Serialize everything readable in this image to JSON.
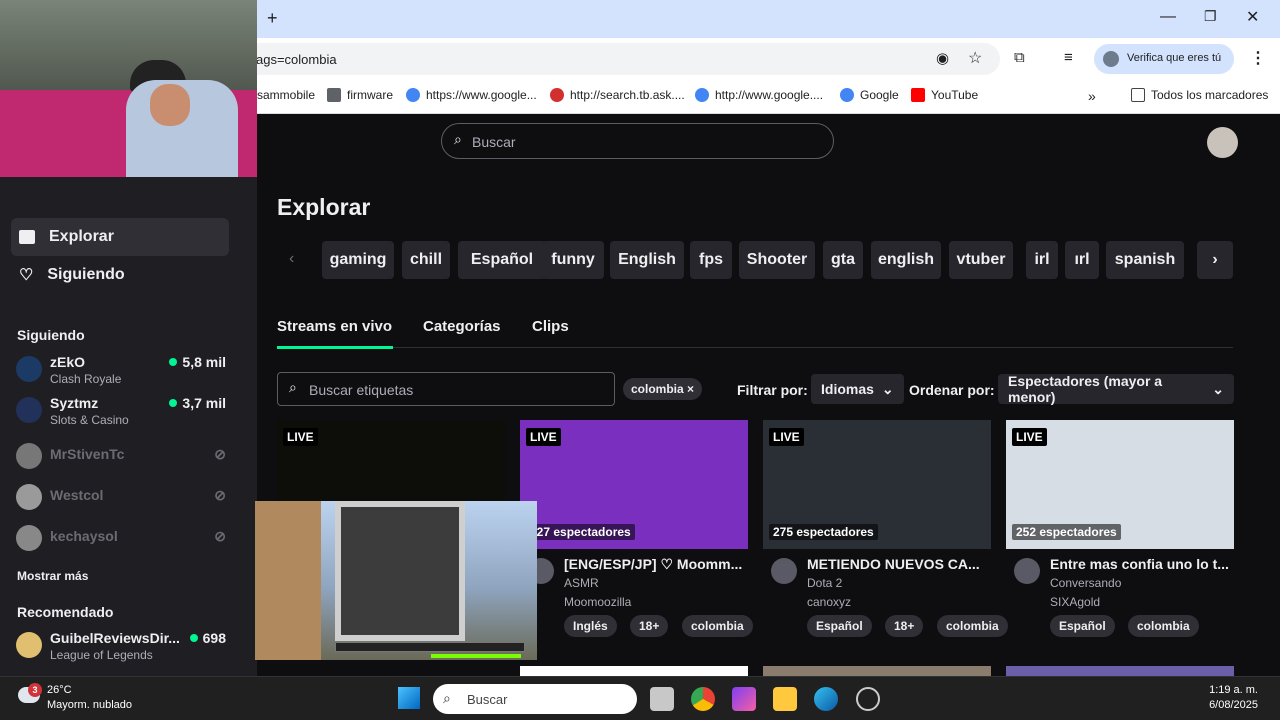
{
  "browser": {
    "new_tab_symbol": "+",
    "url": "ags=colombia",
    "profile_label": "Verifica que eres tú",
    "bookmarks": [
      {
        "label": "sammobile",
        "icon": "none"
      },
      {
        "label": "firmware",
        "icon": "folder-icon"
      },
      {
        "label": "https://www.google...",
        "icon": "google-icon"
      },
      {
        "label": "http://search.tb.ask....",
        "icon": "ask-icon"
      },
      {
        "label": "http://www.google....",
        "icon": "google-icon"
      },
      {
        "label": "Google",
        "icon": "google-icon"
      },
      {
        "label": "YouTube",
        "icon": "youtube-icon"
      }
    ],
    "more_symbol": "»",
    "all_bookmarks_label": "Todos los marcadores"
  },
  "site": {
    "search_placeholder": "Buscar",
    "page_title": "Explorar",
    "nav": [
      {
        "label": "Explorar",
        "icon": "explore-icon",
        "active": true
      },
      {
        "label": "Siguiendo",
        "icon": "heart-icon",
        "active": false
      }
    ],
    "following_heading": "Siguiendo",
    "following": [
      {
        "name": "zEkO",
        "game": "Clash Royale",
        "viewers": "5,8 mil",
        "live": true,
        "color": "#1b3a66"
      },
      {
        "name": "Syztmz",
        "game": "Slots & Casino",
        "viewers": "3,7 mil",
        "live": true,
        "color": "#22315a"
      },
      {
        "name": "MrStivenTc",
        "game": "",
        "viewers": "",
        "live": false,
        "color": "#777777"
      },
      {
        "name": "Westcol",
        "game": "",
        "viewers": "",
        "live": false,
        "color": "#9a9a9a"
      },
      {
        "name": "kechaysol",
        "game": "",
        "viewers": "",
        "live": false,
        "color": "#888888"
      }
    ],
    "show_more": "Mostrar más",
    "recommended_heading": "Recomendado",
    "recommended": [
      {
        "name": "GuibelReviewsDir...",
        "game": "League of Legends",
        "viewers": "698",
        "color": "#e0c070"
      }
    ],
    "chips": [
      "gaming",
      "chill",
      "Español",
      "funny",
      "English",
      "fps",
      "Shooter",
      "gta",
      "english",
      "vtuber",
      "irl",
      "ırl",
      "spanish"
    ],
    "tabs": [
      {
        "label": "Streams en vivo",
        "active": true
      },
      {
        "label": "Categorías",
        "active": false
      },
      {
        "label": "Clips",
        "active": false
      }
    ],
    "tag_search_placeholder": "Buscar etiquetas",
    "active_filter": "colombia ×",
    "filter_label": "Filtrar por:",
    "filter_value": "Idiomas",
    "sort_label": "Ordenar por:",
    "sort_value": "Espectadores (mayor a menor)",
    "live_badge": "LIVE",
    "cards": [
      {
        "viewers": "",
        "title": "",
        "game": "",
        "channel": "",
        "tags": [],
        "thumb": "#0d0d0a"
      },
      {
        "viewers": "327 espectadores",
        "title": "[ENG/ESP/JP] ♡ Moomm...",
        "game": "ASMR",
        "channel": "Moomoozilla",
        "tags": [
          "Inglés",
          "18+",
          "colombia"
        ],
        "thumb": "#7b2fbf"
      },
      {
        "viewers": "275 espectadores",
        "title": "METIENDO NUEVOS CA...",
        "game": "Dota 2",
        "channel": "canoxyz",
        "tags": [
          "Español",
          "18+",
          "colombia"
        ],
        "thumb": "#2a2e35"
      },
      {
        "viewers": "252 espectadores",
        "title": "Entre mas confia uno lo t...",
        "game": "Conversando",
        "channel": "SIXAgold",
        "tags": [
          "Español",
          "colombia"
        ],
        "thumb": "#d7dde4"
      }
    ]
  },
  "taskbar": {
    "weather_temp": "26°C",
    "weather_desc": "Mayorm. nublado",
    "weather_badge": "3",
    "search_placeholder": "Buscar",
    "time": "1:19 a. m.",
    "date": "6/08/2025"
  },
  "colors": {
    "accent": "#00f593",
    "chrome_tab": "#d3e3fd",
    "sidebar": "#1f1f23"
  }
}
